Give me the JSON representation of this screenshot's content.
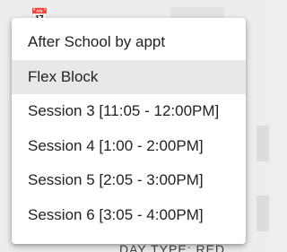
{
  "background": {
    "footer_text": "DAY TYPE: RED"
  },
  "menu": {
    "items": [
      {
        "label": "After School by appt",
        "selected": false
      },
      {
        "label": "Flex Block",
        "selected": true
      },
      {
        "label": "Session 3 [11:05 - 12:00PM]",
        "selected": false
      },
      {
        "label": "Session 4 [1:00 - 2:00PM]",
        "selected": false
      },
      {
        "label": "Session 5 [2:05 - 3:00PM]",
        "selected": false
      },
      {
        "label": "Session 6 [3:05 - 4:00PM]",
        "selected": false
      }
    ]
  },
  "colors": {
    "selected_bg": "#e8e8e8",
    "menu_bg": "#ffffff",
    "page_bg": "#ededed"
  }
}
